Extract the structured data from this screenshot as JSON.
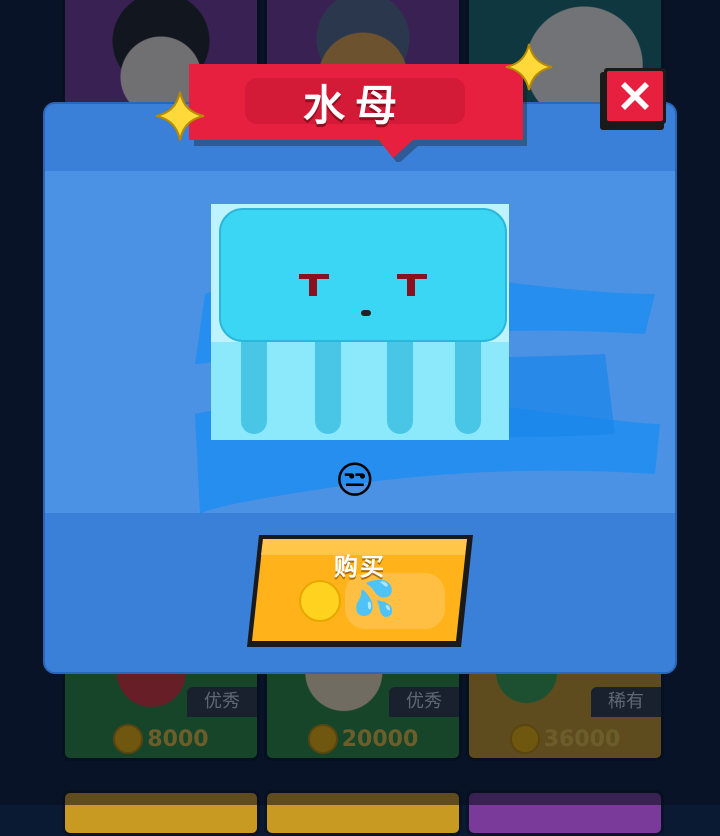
{
  "popup": {
    "title": "水母",
    "mood_emoji": "😒",
    "buy_label": "购买",
    "price_emoji": "💦",
    "close_icon": "close-icon"
  },
  "shop_cards": [
    {
      "tag": "优秀",
      "price": "8000",
      "color": "#2c8a3a"
    },
    {
      "tag": "优秀",
      "price": "20000",
      "color": "#2c8a3a"
    },
    {
      "tag": "稀有",
      "price": "36000",
      "color": "#c99a22"
    }
  ],
  "colors": {
    "modal": "#3a7fd8",
    "ribbon": "#e8203f",
    "button": "#ffb21a"
  }
}
